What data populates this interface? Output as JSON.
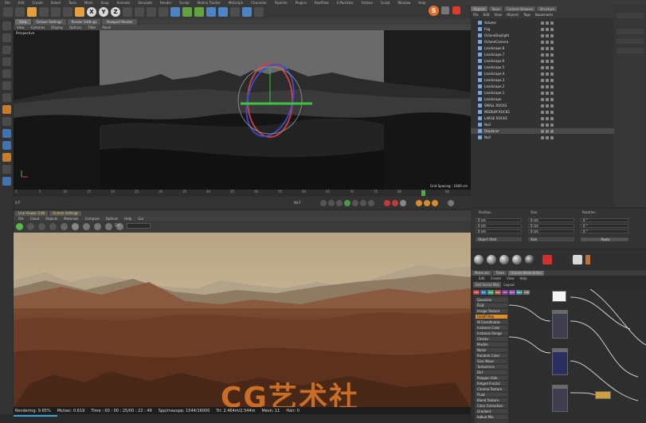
{
  "menubar": {
    "items": [
      "File",
      "Edit",
      "Create",
      "Select",
      "Tools",
      "Mesh",
      "Snap",
      "Animate",
      "Simulate",
      "Render",
      "Sculpt",
      "Motion Tracker",
      "MoGraph",
      "Character",
      "Pipeline",
      "Plugins",
      "RealFlow",
      "X-Particles",
      "Octane",
      "Script",
      "Window",
      "Help"
    ]
  },
  "viewport": {
    "tabs": [
      "View",
      "Octane Settings",
      "Render Settings",
      "Viewport Render"
    ],
    "menu": [
      "View",
      "Cameras",
      "Display",
      "Options",
      "Filter",
      "Panel"
    ],
    "label": "Perspective",
    "grid_spacing": "Grid Spacing : 1000 cm"
  },
  "timeline": {
    "ticks": [
      "0",
      "5",
      "10",
      "15",
      "20",
      "25",
      "30",
      "35",
      "40",
      "45",
      "50",
      "55",
      "60",
      "65",
      "70",
      "75",
      "80",
      "85",
      "90"
    ],
    "frame_start": "0 F",
    "frame_end": "90 F"
  },
  "render_view": {
    "tabs": [
      "Live Viewer 3.06",
      "Octane Settings"
    ],
    "menu": [
      "File",
      "Cloud",
      "Objects",
      "Materials",
      "Compare",
      "Options",
      "Help",
      "Gui"
    ],
    "zoom": "Zm",
    "watermark": "CG艺术社"
  },
  "status": {
    "rendering": "Rendering: 9.65%",
    "ms_sec": "Ms/sec: 0.619",
    "time": "Time : 00 : 00 : 25/00 : 22 : 49",
    "spp": "Spp/maxspp: 1544/16000",
    "tri": "Tri: 2.464m/2.544m",
    "mesh": "Mesh: 11",
    "hair": "Hair: 0",
    "rendering_value": 9.65
  },
  "object_manager": {
    "tabs": [
      "Objects",
      "Takes",
      "Content Browser",
      "Structure"
    ],
    "menu": [
      "File",
      "Edit",
      "View",
      "Objects",
      "Tags",
      "Bookmarks"
    ],
    "objects": [
      "Volume",
      "Fog",
      "OctaneDaylight",
      "OctaneCamera",
      "Landscape.8",
      "Landscape.7",
      "Landscape.6",
      "Landscape.5",
      "Landscape.4",
      "Landscape.3",
      "Landscape.2",
      "Landscape.1",
      "Landscape",
      "SMALL ROCKS",
      "MEDIUM ROCKS",
      "LARGE ROCKS",
      "Null",
      "Displacer",
      "Null"
    ]
  },
  "coordinates": {
    "headers": [
      "Position",
      "Size",
      "Rotation"
    ],
    "pos": [
      "0 cm",
      "0 cm",
      "0 cm"
    ],
    "size": [
      "0 cm",
      "0 cm",
      "0 cm"
    ],
    "rot": [
      "0 °",
      "0 °",
      "0 °"
    ],
    "mode": "Object (Rel)",
    "size_mode": "Size",
    "apply": "Apply"
  },
  "node_editor": {
    "tabs": [
      "Materials",
      "Takes",
      "Octane Node Editor"
    ],
    "menu": [
      "Edit",
      "Create",
      "View",
      "Help"
    ],
    "search_label": "Get Scene Mat",
    "search_value": "Layout",
    "categories": [
      {
        "label": "Mat",
        "color": "#b84141"
      },
      {
        "label": "Tex",
        "color": "#3d6fb0"
      },
      {
        "label": "Gen",
        "color": "#3d9b6b"
      },
      {
        "label": "Map",
        "color": "#a5543a"
      },
      {
        "label": "Oth",
        "color": "#7d3e9a"
      },
      {
        "label": "Emi",
        "color": "#8a4aa5"
      },
      {
        "label": "Med",
        "color": "#3a8a8a"
      },
      {
        "label": "C4D",
        "color": "#6d6d6d"
      }
    ],
    "nodes": [
      "Gaussian Spectrum",
      "RGB",
      "Image Texture",
      "Falloff Map",
      "W Coordinates",
      "Instance Color",
      "Instance Range",
      "Checks",
      "Marble",
      "Noise",
      "Random Color",
      "Sine Wave",
      "Turbulence",
      "Dirt",
      "Polygon Side",
      "Ridged Fractal",
      "Cinema Texture",
      "Float",
      "Blend Texture",
      "Color Correction",
      "Gradient",
      "Ioblue Mix"
    ],
    "selected": "Falloff"
  }
}
